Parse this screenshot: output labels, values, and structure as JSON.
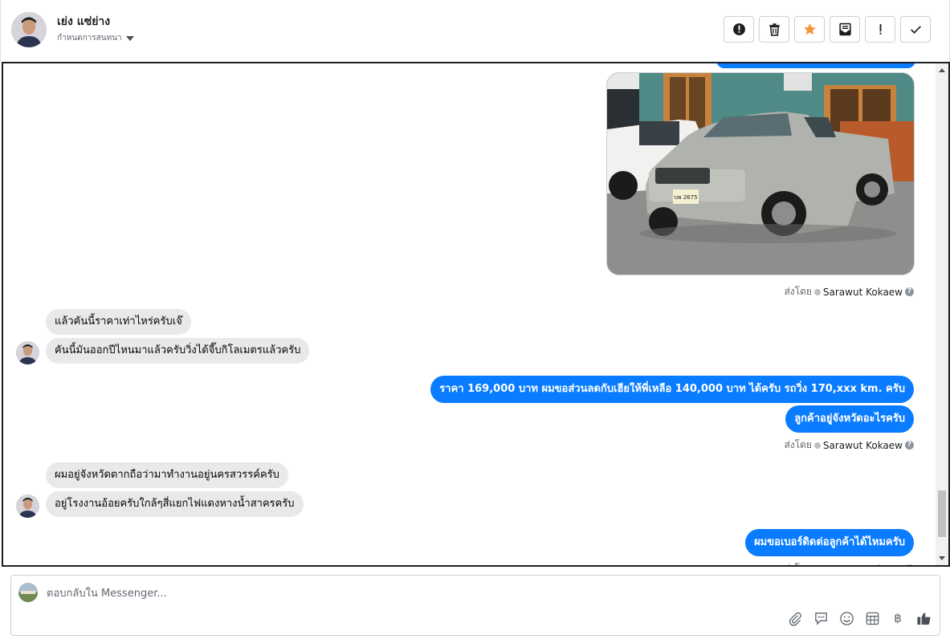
{
  "header": {
    "contact_name": "เย่ง แซ่ย่าง",
    "assign_label": "กำหนดการสนทนา",
    "actions": [
      {
        "name": "spam-button",
        "icon": "alert-circle-icon"
      },
      {
        "name": "delete-button",
        "icon": "trash-icon"
      },
      {
        "name": "star-button",
        "icon": "star-icon"
      },
      {
        "name": "mark-unread-button",
        "icon": "mail-icon"
      },
      {
        "name": "priority-button",
        "icon": "exclamation-icon"
      },
      {
        "name": "done-button",
        "icon": "check-icon"
      }
    ]
  },
  "messages": {
    "sent_by_label": "ส่งโดย",
    "sender_name": "Sarawut Kokaew",
    "in_1": "แล้วคันนี้ราคาเท่าไหร่ครับเจ๊",
    "in_2": "คันนี้มันออกปีไหนมาแล้วครับวิ่งได้จี๊บกิโลเมตรแล้วครับ",
    "out_1": "ราคา 169,000 บาท ผมขอส่วนลดกับเฮียให้พี่เหลือ 140,000 บาท ได้ครับ รถวิ่ง 170,xxx km. ครับ",
    "out_2": "ลูกค้าอยู่จังหวัดอะไรครับ",
    "in_3": "ผมอยู่จังหวัดตากถือว่ามาทำงานอยู่นครสวรรค์ครับ",
    "in_4": "อยู่โรงงานอ้อยครับใกล้ๆสี่แยกไฟแดงหางน้ำสาครครับ",
    "out_3": "ผมขอเบอร์ติดต่อลูกค้าได้ไหมครับ",
    "photo_plate": "บพ 2675"
  },
  "composer": {
    "placeholder": "ตอบกลับใน Messenger...",
    "tools": [
      "attachment-icon",
      "saved-reply-icon",
      "emoji-icon",
      "calculator-icon",
      "baht-icon",
      "thumbs-up-icon"
    ],
    "baht_symbol": "฿"
  },
  "colors": {
    "outgoing_bubble": "#0a7cff",
    "incoming_bubble": "#e9e9eb",
    "star": "#f7923b"
  }
}
